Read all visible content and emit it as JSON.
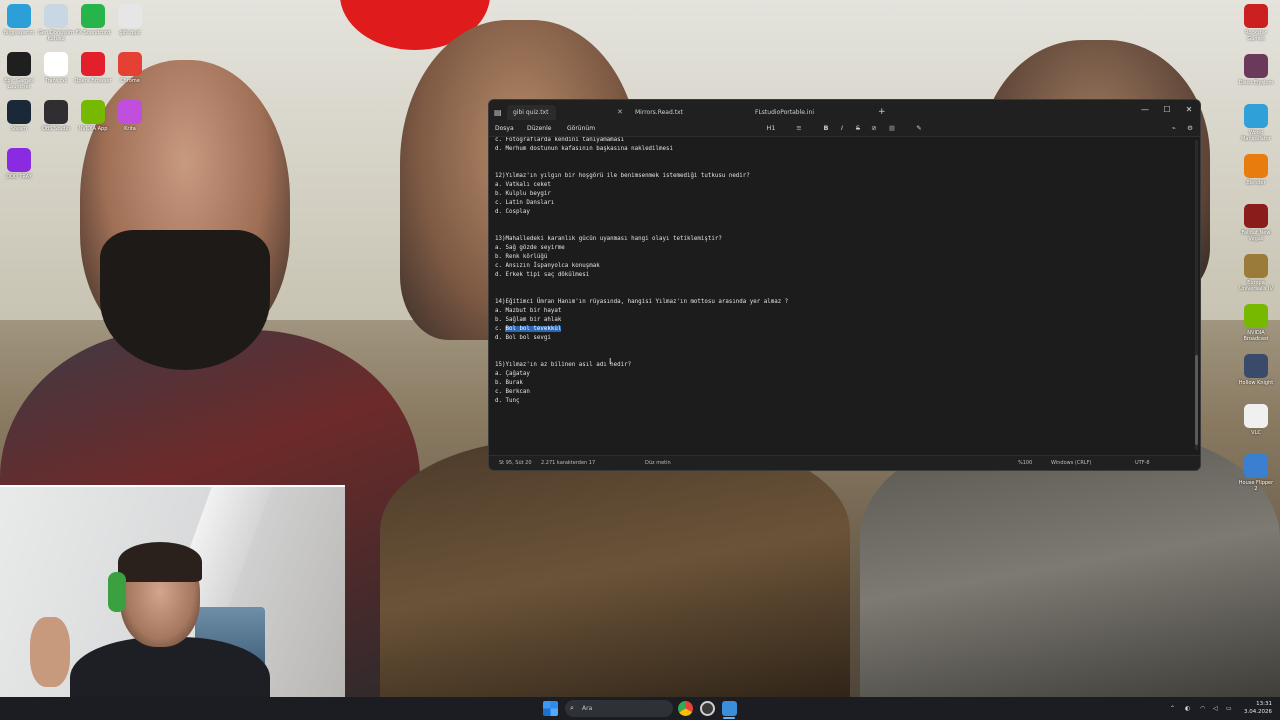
{
  "desktop": {
    "icons_left": [
      {
        "label": "Bilgisayarım",
        "color": "#2d9fd8"
      },
      {
        "label": "Geri Dönüşüm Kutusu",
        "color": "#c9d6e3"
      },
      {
        "label": "FX Soundcord",
        "color": "#25b54a"
      },
      {
        "label": "gibi.quiz",
        "color": "#e6e6e6"
      },
      {
        "label": "Epic Games Launcher",
        "color": "#1f1f1f"
      },
      {
        "label": "Trans.txt",
        "color": "#ffffff"
      },
      {
        "label": "Opera Browser",
        "color": "#e21f2b"
      },
      {
        "label": "Chrome",
        "color": "#e44134"
      },
      {
        "label": "Steam",
        "color": "#1b2838"
      },
      {
        "label": "OBS Studio",
        "color": "#302e31"
      },
      {
        "label": "NVIDIA App",
        "color": "#76b900"
      },
      {
        "label": "Krita",
        "color": "#c04fe0"
      },
      {
        "label": "DDD TRAY",
        "color": "#8a2be2"
      }
    ],
    "icons_right": [
      {
        "label": "Rockstar Games",
        "color": "#cc1f1f"
      },
      {
        "label": "Disco Elysium",
        "color": "#6b3a5a"
      },
      {
        "label": "Wood Manipulator",
        "color": "#2fa0d8"
      },
      {
        "label": "Blender",
        "color": "#e87d0d"
      },
      {
        "label": "Fallout New Vegas",
        "color": "#8a1c1c"
      },
      {
        "label": "Europa Universalis IV",
        "color": "#9a7b3a"
      },
      {
        "label": "NVIDIA Broadcast",
        "color": "#76b900"
      },
      {
        "label": "Hollow Knight",
        "color": "#3a4a6a"
      },
      {
        "label": "VLC",
        "color": "#f0f0f0"
      },
      {
        "label": "House Flipper 2",
        "color": "#3a7fd0"
      }
    ]
  },
  "notepad": {
    "tabs": [
      {
        "label": "gibi quiz.txt",
        "active": true
      },
      {
        "label": "Mirrors.Read.txt",
        "active": false
      },
      {
        "label": "FLstudioPortable.ini",
        "active": false
      }
    ],
    "new_tab_icon": "plus-icon",
    "window_controls": [
      "minimize-icon",
      "maximize-icon",
      "close-icon"
    ],
    "menu": [
      "Dosya",
      "Düzenle",
      "Görünüm"
    ],
    "toolbar": [
      "H1",
      "≡",
      "B",
      "I",
      "S",
      "⊘",
      "🔗",
      "▦",
      "✎"
    ],
    "lines": [
      "c. Fotoğraflarda kendini tanıyamaması",
      "d. Merhum dostunun kafasının başkasına nakledilmesi",
      "",
      "",
      "12)Yılmaz'ın yılgın bir hoşgörü ile benimsenmek istemediği tutkusu nedir?",
      "a. Vatkalı ceket",
      "b. Kulplu beygir",
      "c. Latin Dansları",
      "d. Cosplay",
      "",
      "",
      "13)Mahalledeki karanlık gücün uyanması hangi olayı tetiklemiştir?",
      "a. Sağ gözde seyirme",
      "b. Renk körlüğü",
      "c. Ansızın İspanyolca konuşmak",
      "d. Erkek tipi saç dökülmesi",
      "",
      "",
      "14)Eğitimci Ümran Hanım'ın rüyasında, hangisi Yılmaz'ın mottosu arasında yer almaz ?",
      "a. Mazbut bir hayat",
      "b. Sağlam bir ahlak",
      "c. Bol bol tevekkül",
      "d. Bol bol sevgi",
      "",
      "",
      "15)Yılmaz'ın az bilinen asıl adı nedir?",
      "a. Çağatay",
      "b. Burak",
      "c. Berkcan",
      "d. Tunç"
    ],
    "selected_line_prefix": "c. ",
    "selected_text": "Bol bol tevekkül",
    "status": {
      "position": "St 95, Süt 20",
      "chars": "2.271 karakterden 17",
      "format": "Düz metin",
      "zoom": "%100",
      "line_ending": "Windows (CRLF)",
      "encoding": "UTF-8"
    }
  },
  "taskbar": {
    "search_placeholder": "Ara",
    "time": "13:31",
    "date": "3.04.2026"
  }
}
